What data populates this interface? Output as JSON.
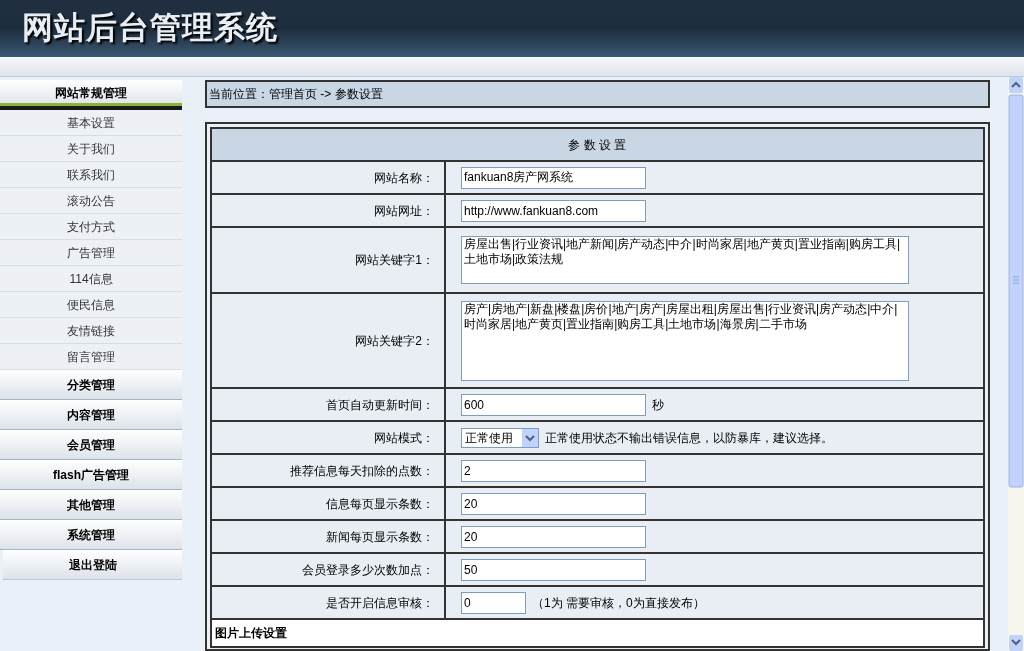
{
  "header": {
    "title": "网站后台管理系统"
  },
  "sidebar": {
    "sections": [
      {
        "label": "网站常规管理",
        "expanded": true,
        "items": [
          "基本设置",
          "关于我们",
          "联系我们",
          "滚动公告",
          "支付方式",
          "广告管理",
          "114信息",
          "便民信息",
          "友情链接",
          "留言管理"
        ]
      },
      {
        "label": "分类管理",
        "expanded": false
      },
      {
        "label": "内容管理",
        "expanded": false
      },
      {
        "label": "会员管理",
        "expanded": false
      },
      {
        "label": "flash广告管理",
        "expanded": false
      },
      {
        "label": "其他管理",
        "expanded": false
      },
      {
        "label": "系统管理",
        "expanded": false
      }
    ],
    "logout": "退出登陆"
  },
  "breadcrumb": "当前位置：管理首页 -> 参数设置",
  "form": {
    "title": "参 数 设 置",
    "rows": [
      {
        "kind": "text",
        "label": "网站名称：",
        "value": "fankuan8房产网系统"
      },
      {
        "kind": "text",
        "label": "网站网址：",
        "value": "http://www.fankuan8.com"
      },
      {
        "kind": "textarea",
        "label": "网站关键字1：",
        "value": "房屋出售|行业资讯|地产新闻|房产动态|中介|时尚家居|地产黄页|置业指南|购房工具|土地市场|政策法规"
      },
      {
        "kind": "textarea",
        "label": "网站关键字2：",
        "value": "房产|房地产|新盘|楼盘|房价|地产|房产|房屋出租|房屋出售|行业资讯|房产动态|中介|时尚家居|地产黄页|置业指南|购房工具|土地市场|海景房|二手市场"
      },
      {
        "kind": "text",
        "label": "首页自动更新时间：",
        "value": "600",
        "suffix": "秒"
      },
      {
        "kind": "select",
        "label": "网站模式：",
        "value": "正常使用",
        "suffix": "正常使用状态不输出错误信息，以防暴库，建议选择。"
      },
      {
        "kind": "text",
        "label": "推荐信息每天扣除的点数：",
        "value": "2"
      },
      {
        "kind": "text",
        "label": "信息每页显示条数：",
        "value": "20"
      },
      {
        "kind": "text",
        "label": "新闻每页显示条数：",
        "value": "20"
      },
      {
        "kind": "text",
        "label": "会员登录多少次数加点：",
        "value": "50"
      },
      {
        "kind": "narrow",
        "label": "是否开启信息审核：",
        "value": "0",
        "suffix": "（1为 需要审核，0为直接发布）"
      }
    ],
    "section_heading": "图片上传设置"
  }
}
